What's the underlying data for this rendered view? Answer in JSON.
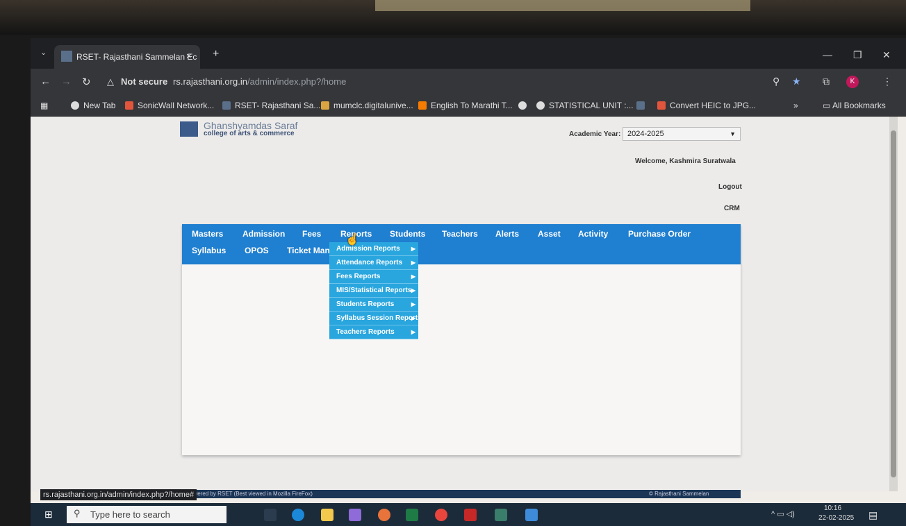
{
  "browser": {
    "tab_title": "RSET- Rajasthani Sammelan Ec",
    "tab_close": "×",
    "new_tab": "+",
    "not_secure": "Not secure",
    "url_host": "rs.rajasthani.org.in",
    "url_path": "/admin/index.php?/home",
    "profile_initial": "K",
    "bookmarks": [
      {
        "label": "New Tab",
        "color": "#dddddd"
      },
      {
        "label": "SonicWall Network...",
        "color": "#e2553d"
      },
      {
        "label": "RSET- Rajasthani Sa...",
        "color": "#5a6f8a"
      },
      {
        "label": "mumclc.digitalunive...",
        "color": "#d9a441"
      },
      {
        "label": "English To Marathi T...",
        "color": "#f57c00"
      },
      {
        "label": "STATISTICAL UNIT :...",
        "color": "#dddddd"
      },
      {
        "label": "Convert HEIC to JPG...",
        "color": "#e2553d"
      }
    ],
    "more_bookmarks": "»",
    "all_bookmarks": "All Bookmarks",
    "status_url": "rs.rajasthani.org.in/admin/index.php?/home#"
  },
  "header": {
    "college_name": "Ghanshyamdas Saraf",
    "college_sub": "college of arts & commerce",
    "academic_year_label": "Academic Year:",
    "academic_year_value": "2024-2025",
    "welcome": "Welcome, Kashmira Suratwala",
    "logout": "Logout",
    "crm": "CRM"
  },
  "menu": {
    "row1": [
      "Masters",
      "Admission",
      "Fees",
      "Reports",
      "Students",
      "Teachers",
      "Alerts",
      "Asset",
      "Activity",
      "Purchase Order"
    ],
    "row2": [
      "Syllabus",
      "OPOS",
      "Ticket Mana"
    ]
  },
  "reports_submenu": [
    "Admission Reports",
    "Attendance Reports",
    "Fees Reports",
    "MIS/Statistical Reports",
    "Students Reports",
    "Syllabus Session Reports",
    "Teachers Reports"
  ],
  "footer": {
    "left": "owered by RSET (Best viewed in Mozilla FireFox)",
    "right": "© Rajasthani Sammelan"
  },
  "taskbar": {
    "search_placeholder": "Type here to search",
    "time": "10:16",
    "date": "22-02-2025"
  },
  "colors": {
    "menu_blue": "#1f7fd0",
    "submenu_blue": "#2aa6df"
  }
}
